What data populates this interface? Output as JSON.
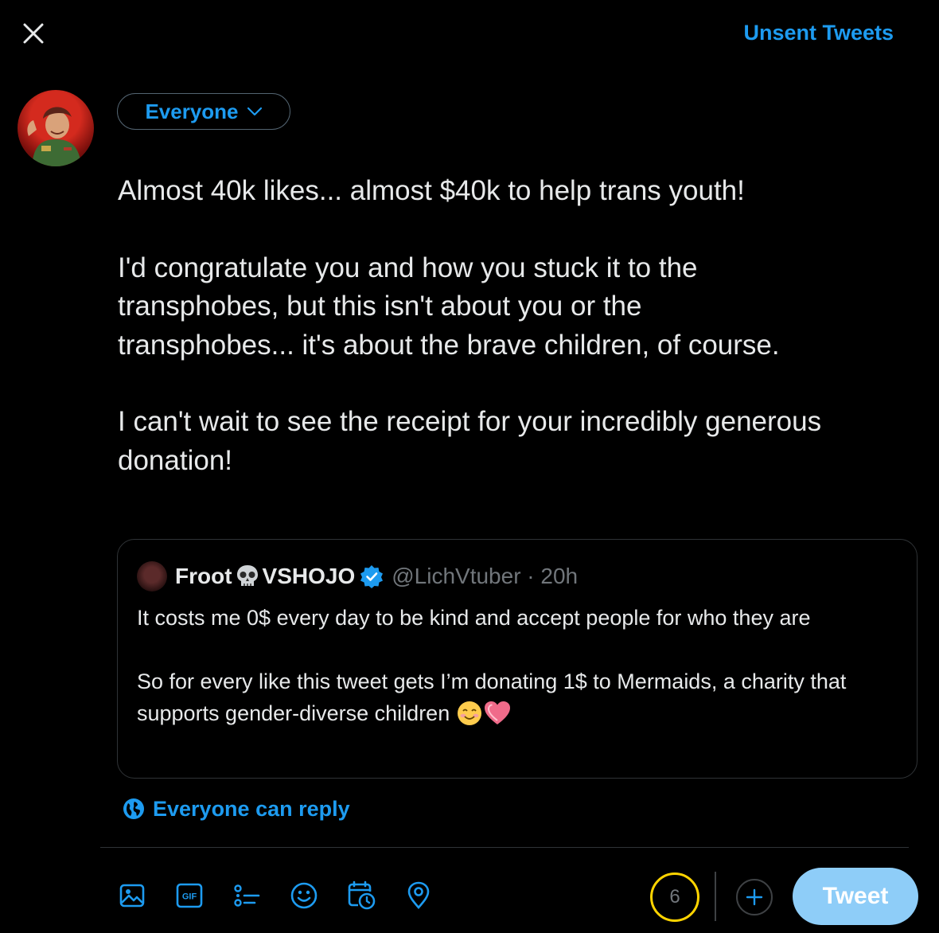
{
  "header": {
    "unsent_label": "Unsent Tweets"
  },
  "composer": {
    "audience_label": "Everyone",
    "paragraphs": [
      "Almost 40k likes... almost $40k to help trans youth!",
      "I'd congratulate you and how you stuck it to the\ntransphobes, but this isn't about you or the\ntransphobes... it's about the brave children, of course.",
      "I can't wait to see the receipt for your incredibly generous\ndonation!"
    ]
  },
  "quoted_tweet": {
    "name_part1": "Froot",
    "name_part2": "VSHOJO",
    "handle_time": "@LichVtuber · 20h",
    "paragraph1": "It costs me 0$ every day to be kind and accept people for who they are",
    "paragraph2": "So for every like this tweet gets I’m donating 1$ to Mermaids, a charity that supports gender-diverse children"
  },
  "reply_setting": {
    "label": "Everyone can reply"
  },
  "toolbar": {
    "gif_label": "GIF",
    "char_count": "6",
    "tweet_label": "Tweet"
  },
  "colors": {
    "accent": "#1d9bf0",
    "tweet_button": "#8ecdf8",
    "counter_ring": "#ffd400",
    "border": "#2f3336"
  }
}
